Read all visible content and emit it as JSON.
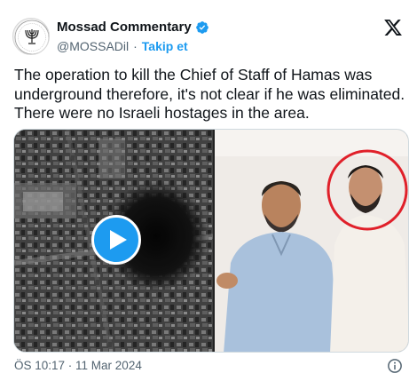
{
  "account": {
    "name": "Mossad Commentary",
    "handle": "@MOSSADil",
    "separator": "·",
    "follow_label": "Takip et"
  },
  "tweet": {
    "text": "The operation to kill the Chief of Staff of Hamas was underground therefore, it's not clear if he was eliminated. There were no Israeli hostages in the area."
  },
  "media": {
    "left": {
      "type": "video",
      "icon": "play-icon"
    },
    "right": {
      "type": "photo"
    }
  },
  "footer": {
    "timestamp": "ÖS 10:17 · 11 Mar 2024",
    "info_icon": "info-icon"
  },
  "colors": {
    "accent": "#1d9bf0",
    "text": "#0f1419",
    "secondary": "#536471",
    "highlight_circle": "#e0202a"
  }
}
